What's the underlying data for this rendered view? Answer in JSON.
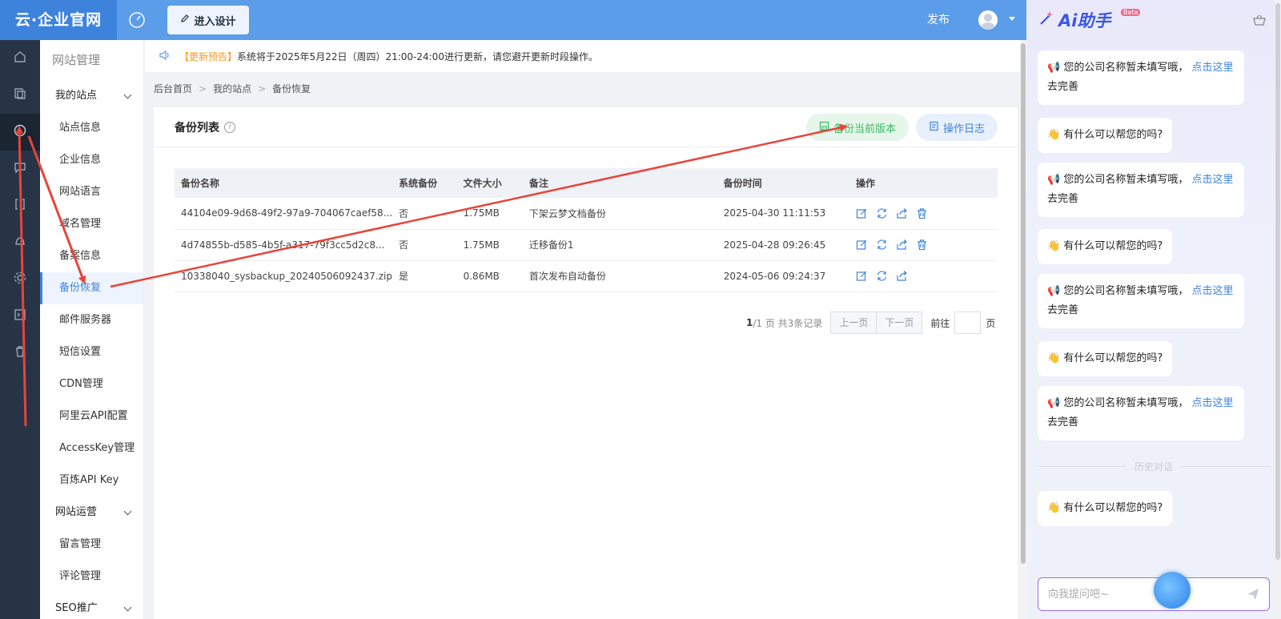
{
  "header": {
    "logo": "云·企业官网",
    "design_button": "进入设计",
    "publish": "发布"
  },
  "rail": [
    "home-icon",
    "copy-icon",
    "globe-icon",
    "chat-icon",
    "bracket-icon",
    "bell-icon",
    "gear-icon",
    "terminal-icon",
    "trash-icon"
  ],
  "menu": {
    "title": "网站管理",
    "groups": [
      {
        "label": "我的站点",
        "items": [
          "站点信息",
          "企业信息",
          "网站语言",
          "域名管理",
          "备案信息",
          "备份恢复",
          "邮件服务器",
          "短信设置",
          "CDN管理",
          "阿里云API配置",
          "AccessKey管理",
          "百炼API Key"
        ]
      },
      {
        "label": "网站运营",
        "items": [
          "留言管理",
          "评论管理"
        ]
      },
      {
        "label": "SEO推广",
        "items": []
      }
    ],
    "active_item": "备份恢复"
  },
  "notice": {
    "tag": "【更新预告】",
    "text": "系统将于2025年5月22日（周四）21:00-24:00进行更新，请您避开更新时段操作。"
  },
  "breadcrumb": [
    "后台首页",
    "我的站点",
    "备份恢复"
  ],
  "panel": {
    "title": "备份列表",
    "backup_button": "备份当前版本",
    "log_button": "操作日志"
  },
  "table": {
    "columns": [
      "备份名称",
      "系统备份",
      "文件大小",
      "备注",
      "备份时间",
      "操作"
    ],
    "rows": [
      {
        "name": "44104e09-9d68-49f2-97a9-704067caef58...",
        "system": "否",
        "size": "1.75MB",
        "note": "下架云梦文档备份",
        "time": "2025-04-30 11:11:53",
        "can_delete": true
      },
      {
        "name": "4d74855b-d585-4b5f-a317-79f3cc5d2c8...",
        "system": "否",
        "size": "1.75MB",
        "note": "迁移备份1",
        "time": "2025-04-28 09:26:45",
        "can_delete": true
      },
      {
        "name": "10338040_sysbackup_20240506092437.zip",
        "system": "是",
        "size": "0.86MB",
        "note": "首次发布自动备份",
        "time": "2024-05-06 09:24:37",
        "can_delete": false
      }
    ]
  },
  "pager": {
    "current": "1",
    "total_text": "/1 页 共3条记录",
    "prev": "上一页",
    "next": "下一页",
    "goto": "前往",
    "unit": "页"
  },
  "ai": {
    "title": "Ai助手",
    "badge": "Beta",
    "messages": [
      {
        "type": "notice",
        "text": "您的公司名称暂未填写哦，",
        "link": "点击这里",
        "tail": "去完善"
      },
      {
        "type": "greet",
        "text": "有什么可以帮您的吗?"
      },
      {
        "type": "notice",
        "text": "您的公司名称暂未填写哦，",
        "link": "点击这里",
        "tail": "去完善"
      },
      {
        "type": "greet",
        "text": "有什么可以帮您的吗?"
      },
      {
        "type": "notice",
        "text": "您的公司名称暂未填写哦，",
        "link": "点击这里",
        "tail": "去完善"
      },
      {
        "type": "greet",
        "text": "有什么可以帮您的吗?"
      },
      {
        "type": "notice",
        "text": "您的公司名称暂未填写哦，",
        "link": "点击这里",
        "tail": "去完善"
      }
    ],
    "divider": "历史对话",
    "history_message": "有什么可以帮您的吗?",
    "input_placeholder": "向我提问吧~"
  },
  "colors": {
    "accent": "#3d83dc",
    "header": "#5b9de8",
    "arrow": "#e8443a",
    "success": "#3ab862"
  }
}
